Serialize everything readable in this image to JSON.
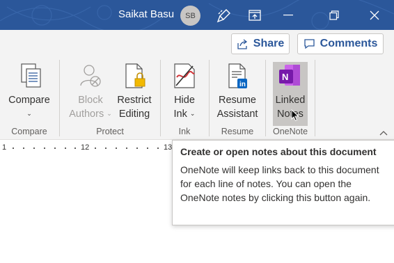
{
  "titlebar": {
    "user_name": "Saikat Basu",
    "avatar_initials": "SB",
    "icons": [
      "brush-icon",
      "restore-ribbon-icon",
      "minimize-icon",
      "maximize-icon",
      "close-icon"
    ],
    "color": "#2b579a"
  },
  "actions": {
    "share_label": "Share",
    "comments_label": "Comments"
  },
  "ribbon": {
    "commands": {
      "compare": {
        "line1": "Compare",
        "chevron": "⌄"
      },
      "block_authors": {
        "line1": "Block",
        "line2": "Authors",
        "chevron": "⌄"
      },
      "restrict_editing": {
        "line1": "Restrict",
        "line2": "Editing"
      },
      "hide_ink": {
        "line1": "Hide",
        "line2": "Ink",
        "chevron": "⌄"
      },
      "resume_assistant": {
        "line1": "Resume",
        "line2": "Assistant"
      },
      "linked_notes": {
        "line1": "Linked",
        "line2": "Notes"
      }
    },
    "groups": {
      "compare": "Compare",
      "protect": "Protect",
      "ink": "Ink",
      "resume": "Resume",
      "onenote": "OneNote"
    },
    "collapse_glyph": "^"
  },
  "ruler": {
    "labels": [
      "1",
      "12",
      "13"
    ]
  },
  "tooltip": {
    "title": "Create or open notes about this document",
    "body": "OneNote will keep links back to this document for each line of notes. You can open the OneNote notes by clicking this button again."
  }
}
